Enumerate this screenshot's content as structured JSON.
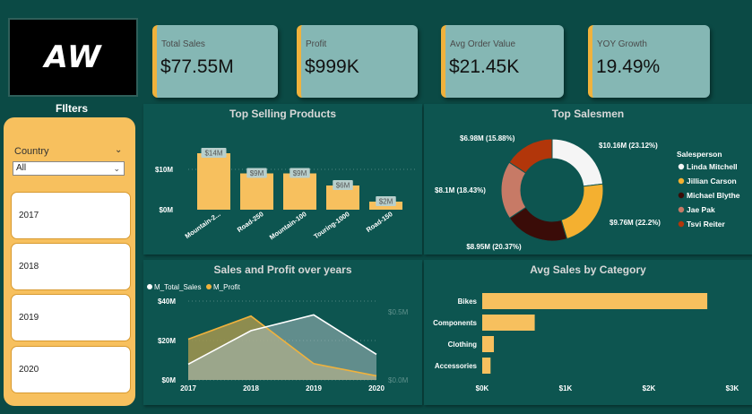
{
  "logo_text": "AW",
  "filters": {
    "title": "FIlters",
    "country_label": "Country",
    "country_value": "All",
    "years": [
      "2017",
      "2018",
      "2019",
      "2020"
    ]
  },
  "kpis": [
    {
      "label": "Total Sales",
      "value": "$77.55M"
    },
    {
      "label": "Profit",
      "value": "$999K"
    },
    {
      "label": "Avg Order Value",
      "value": "$21.45K"
    },
    {
      "label": "YOY Growth",
      "value": "19.49%"
    }
  ],
  "colors": {
    "accent": "#f0b23c",
    "bar": "#f7c05e",
    "background": "#0b4a45",
    "kpi_card": "#85b7b4"
  },
  "chart_data": [
    {
      "type": "bar",
      "title": "Top Selling Products",
      "categories": [
        "Mountain-2...",
        "Road-250",
        "Mountain-100",
        "Touring-1000",
        "Road-150"
      ],
      "values": [
        14,
        9,
        9,
        6,
        2
      ],
      "data_labels": [
        "$14M",
        "$9M",
        "$9M",
        "$6M",
        "$2M"
      ],
      "y_ticks": [
        "$0M",
        "$10M"
      ],
      "ylim": [
        0,
        16
      ]
    },
    {
      "type": "pie",
      "title": "Top Salesmen",
      "legend_title": "Salesperson",
      "slices": [
        {
          "name": "Linda Mitchell",
          "value": 23.12,
          "label": "$10.16M (23.12%)",
          "color": "#f5f5f5"
        },
        {
          "name": "Jillian Carson",
          "value": 22.2,
          "label": "$9.76M (22.2%)",
          "color": "#f4b030"
        },
        {
          "name": "Michael Blythe",
          "value": 20.37,
          "label": "$8.95M (20.37%)",
          "color": "#3a0c08"
        },
        {
          "name": "Jae Pak",
          "value": 18.43,
          "label": "$8.1M (18.43%)",
          "color": "#c77a66"
        },
        {
          "name": "Tsvi Reiter",
          "value": 15.88,
          "label": "$6.98M (15.88%)",
          "color": "#b2360a"
        }
      ]
    },
    {
      "type": "area",
      "title": "Sales and Profit over years",
      "x": [
        "2017",
        "2018",
        "2019",
        "2020"
      ],
      "series": [
        {
          "name": "M_Total_Sales",
          "values": [
            8,
            25,
            33,
            13
          ],
          "color": "#ffffff",
          "axis": "left"
        },
        {
          "name": "M_Profit",
          "values": [
            0.3,
            0.47,
            0.12,
            0.03
          ],
          "color": "#f0b23c",
          "axis": "right"
        }
      ],
      "y_ticks_left": [
        "$0M",
        "$20M",
        "$40M"
      ],
      "y_ticks_right": [
        "$0.0M",
        "$0.5M"
      ],
      "ylim_left": [
        0,
        40
      ],
      "ylim_right": [
        0,
        0.58
      ]
    },
    {
      "type": "bar",
      "orientation": "horizontal",
      "title": "Avg Sales by Category",
      "categories": [
        "Bikes",
        "Components",
        "Clothing",
        "Accessories"
      ],
      "values": [
        2.7,
        0.63,
        0.14,
        0.1
      ],
      "x_ticks": [
        "$0K",
        "$1K",
        "$2K",
        "$3K"
      ],
      "xlim": [
        0,
        3
      ]
    }
  ]
}
